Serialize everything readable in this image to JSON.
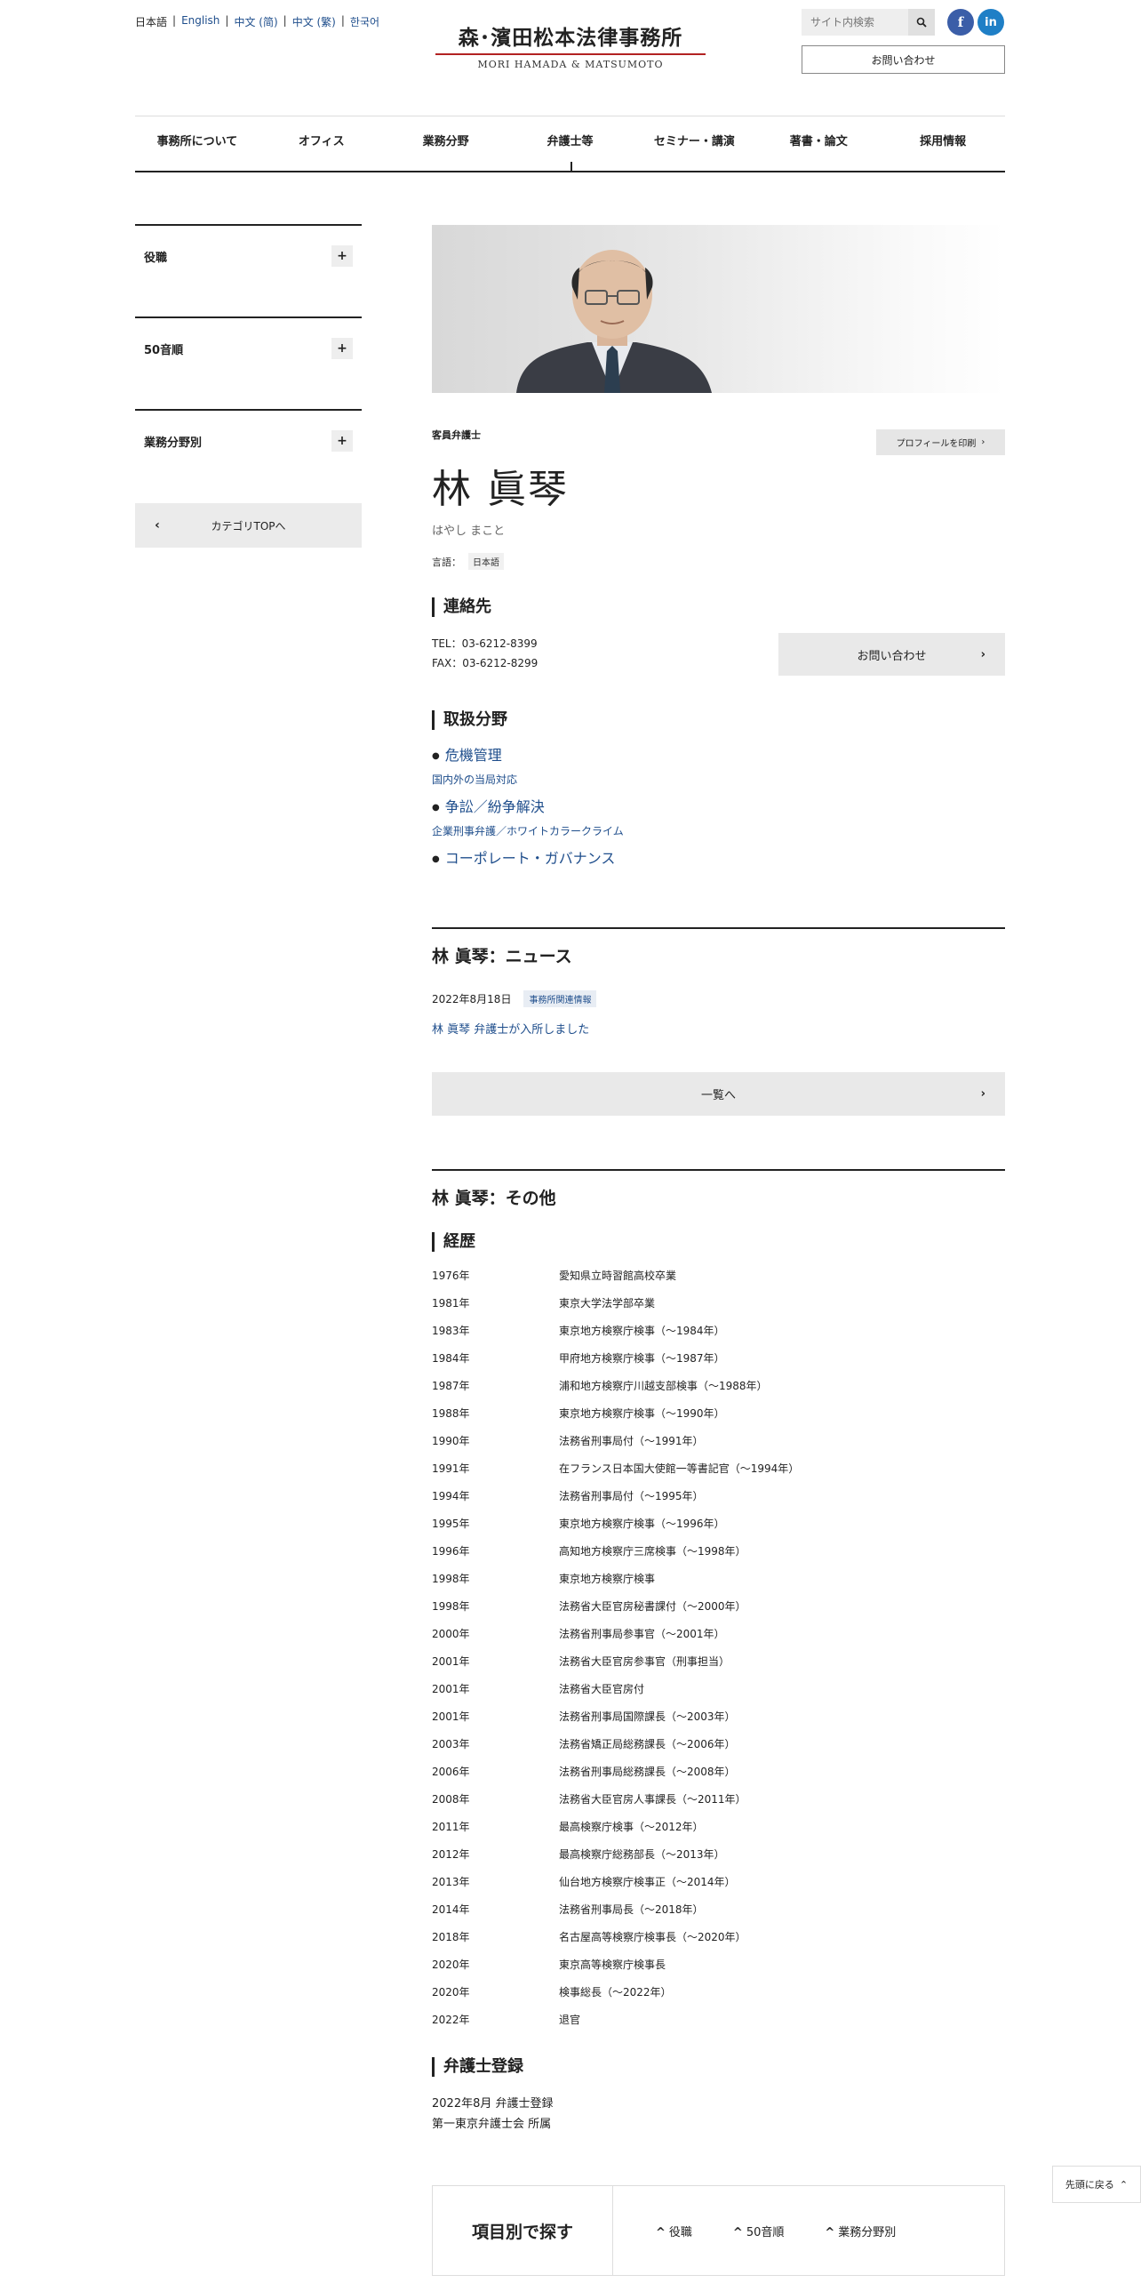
{
  "header": {
    "languages": [
      "日本語",
      "English",
      "中文 (简)",
      "中文 (繁)",
      "한국어"
    ],
    "logo_jp": "森･濱田松本法律事務所",
    "logo_en": "MORI HAMADA & MATSUMOTO",
    "search_placeholder": "サイト内検索",
    "facebook_label": "f",
    "linkedin_label": "in",
    "contact_label": "お問い合わせ"
  },
  "nav": [
    "事務所について",
    "オフィス",
    "業務分野",
    "弁護士等",
    "セミナー・講演",
    "著書・論文",
    "採用情報"
  ],
  "sidebar": {
    "items": [
      {
        "label": "役職",
        "toggle": "+"
      },
      {
        "label": "50音順",
        "toggle": "+"
      },
      {
        "label": "業務分野別",
        "toggle": "+"
      }
    ],
    "category_top": "カテゴリTOPへ"
  },
  "profile": {
    "role": "客員弁護士",
    "print_label": "プロフィールを印刷",
    "name": "林 眞琴",
    "kana": "はやし まこと",
    "language_label": "言語：",
    "language_value": "日本語"
  },
  "contact": {
    "heading": "連絡先",
    "tel": "TEL：03-6212-8399",
    "fax": "FAX：03-6212-8299",
    "button": "お問い合わせ"
  },
  "practice": {
    "heading": "取扱分野",
    "items": [
      {
        "main": "危機管理",
        "sub": "国内外の当局対応"
      },
      {
        "main": "争訟／紛争解決",
        "sub": "企業刑事弁護／ホワイトカラークライム"
      },
      {
        "main": "コーポレート・ガバナンス",
        "sub": ""
      }
    ]
  },
  "news": {
    "heading": "林 眞琴：ニュース",
    "date": "2022年8月18日",
    "tag": "事務所関連情報",
    "title": "林 眞琴 弁護士が入所しました",
    "more": "一覧へ"
  },
  "other": {
    "heading": "林 眞琴：その他",
    "career_heading": "経歴",
    "career": [
      {
        "year": "1976年",
        "text": "愛知県立時習館高校卒業"
      },
      {
        "year": "1981年",
        "text": "東京大学法学部卒業"
      },
      {
        "year": "1983年",
        "text": "東京地方検察庁検事（～1984年）"
      },
      {
        "year": "1984年",
        "text": "甲府地方検察庁検事（～1987年）"
      },
      {
        "year": "1987年",
        "text": "浦和地方検察庁川越支部検事（～1988年）"
      },
      {
        "year": "1988年",
        "text": "東京地方検察庁検事（～1990年）"
      },
      {
        "year": "1990年",
        "text": "法務省刑事局付（～1991年）"
      },
      {
        "year": "1991年",
        "text": "在フランス日本国大使館一等書記官（～1994年）"
      },
      {
        "year": "1994年",
        "text": "法務省刑事局付（～1995年）"
      },
      {
        "year": "1995年",
        "text": "東京地方検察庁検事（～1996年）"
      },
      {
        "year": "1996年",
        "text": "高知地方検察庁三席検事（～1998年）"
      },
      {
        "year": "1998年",
        "text": "東京地方検察庁検事"
      },
      {
        "year": "1998年",
        "text": "法務省大臣官房秘書課付（～2000年）"
      },
      {
        "year": "2000年",
        "text": "法務省刑事局参事官（～2001年）"
      },
      {
        "year": "2001年",
        "text": "法務省大臣官房参事官（刑事担当）"
      },
      {
        "year": "2001年",
        "text": "法務省大臣官房付"
      },
      {
        "year": "2001年",
        "text": "法務省刑事局国際課長（～2003年）"
      },
      {
        "year": "2003年",
        "text": "法務省矯正局総務課長（～2006年）"
      },
      {
        "year": "2006年",
        "text": "法務省刑事局総務課長（～2008年）"
      },
      {
        "year": "2008年",
        "text": "法務省大臣官房人事課長（～2011年）"
      },
      {
        "year": "2011年",
        "text": "最高検察庁検事（～2012年）"
      },
      {
        "year": "2012年",
        "text": "最高検察庁総務部長（～2013年）"
      },
      {
        "year": "2013年",
        "text": "仙台地方検察庁検事正（～2014年）"
      },
      {
        "year": "2014年",
        "text": "法務省刑事局長（～2018年）"
      },
      {
        "year": "2018年",
        "text": "名古屋高等検察庁検事長（～2020年）"
      },
      {
        "year": "2020年",
        "text": "東京高等検察庁検事長"
      },
      {
        "year": "2020年",
        "text": "検事総長（～2022年）"
      },
      {
        "year": "2022年",
        "text": "退官"
      }
    ],
    "registration_heading": "弁護士登録",
    "registration_line1": "2022年8月 弁護士登録",
    "registration_line2": "第一東京弁護士会 所属"
  },
  "footer": {
    "back_to_top": "先頭に戻る",
    "find_title": "項目別で探す",
    "find_links": [
      "役職",
      "50音順",
      "業務分野別"
    ]
  }
}
